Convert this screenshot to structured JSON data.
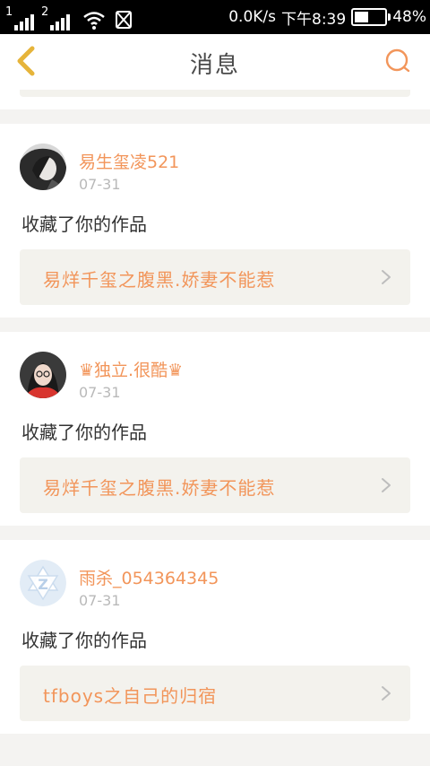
{
  "status_bar": {
    "sim1": "1",
    "sim2": "2",
    "speed": "0.0K/s",
    "time": "下午8:39",
    "battery": "48%",
    "battery_level": 0.48
  },
  "header": {
    "title": "消息",
    "back_icon": "chevron-left-icon",
    "search_icon": "search-icon",
    "accent": "#e6b43a"
  },
  "colors": {
    "accent_orange": "#f2955a",
    "date_gray": "#b9b9b9",
    "box_bg": "#f3f2ed"
  },
  "messages": [
    {
      "username": "易生玺凌521",
      "date": "07-31",
      "action": "收藏了你的作品",
      "work_title": "易烊千玺之腹黑.娇妻不能惹"
    },
    {
      "username": "♛独立.很酷♛",
      "date": "07-31",
      "action": "收藏了你的作品",
      "work_title": "易烊千玺之腹黑.娇妻不能惹"
    },
    {
      "username": "雨杀_054364345",
      "date": "07-31",
      "action": "收藏了你的作品",
      "work_title": "tfboys之自己的归宿"
    }
  ]
}
